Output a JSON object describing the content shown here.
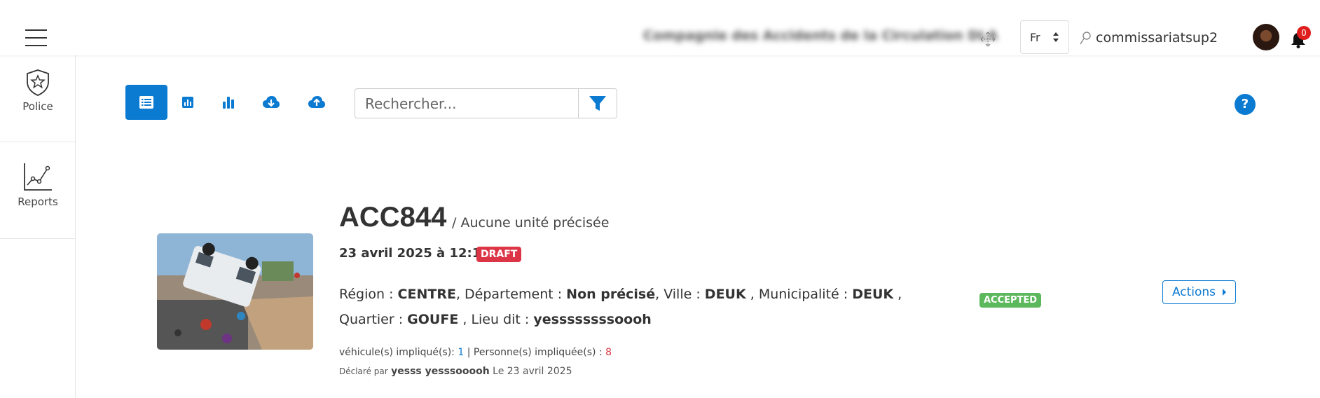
{
  "header": {
    "company": "Compagnie des Accidents de la Circulation DLA",
    "language": "Fr",
    "username": "commissariatsup2",
    "notifications_count": "0"
  },
  "sidebar": {
    "items": [
      {
        "label": "Police",
        "icon": "shield-star-icon"
      },
      {
        "label": "Reports",
        "icon": "line-chart-icon"
      }
    ]
  },
  "toolbar": {
    "buttons": [
      "list-view-icon",
      "bar-chart-small-icon",
      "bar-chart-icon",
      "cloud-download-icon",
      "cloud-upload-icon"
    ],
    "search_placeholder": "Rechercher...",
    "help_label": "?"
  },
  "accident": {
    "code": "ACC844",
    "unit": "/ Aucune unité précisée",
    "date": "23 avril 2025 à 12:14",
    "status_badge": "DRAFT",
    "region_label": "Région :",
    "region": "CENTRE",
    "departement_label": ", Département :",
    "departement": "Non précisé",
    "ville_label": ", Ville :",
    "ville": "DEUK",
    "municipalite_label": ", Municipalité :",
    "municipalite": "DEUK",
    "quartier_label": ", Quartier :",
    "quartier": "GOUFE",
    "lieu_label": ", Lieu dit :",
    "lieu": "yessssssssoooh",
    "review_badge": "ACCEPTED",
    "actions_label": "Actions",
    "vehicles_label": "véhicule(s) impliqué(s):",
    "vehicles_count": "1",
    "persons_label": "| Personne(s) impliquée(s) :",
    "persons_count": "8",
    "declared_prefix": "Déclaré par",
    "declared_by": "yesss yesssooooh",
    "declared_on": "Le 23 avril 2025"
  },
  "colors": {
    "primary": "#0b7ad1",
    "draft": "#dc3545",
    "accepted": "#5cb85c"
  }
}
